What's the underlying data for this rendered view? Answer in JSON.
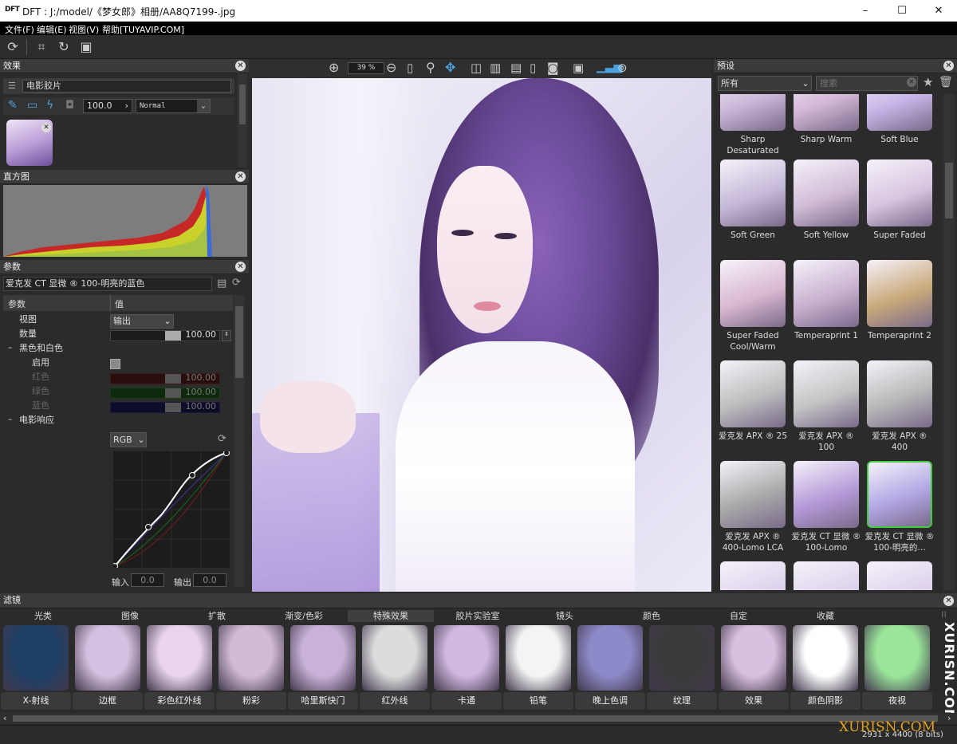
{
  "window": {
    "app_logo": "DFT",
    "title": "DFT : J:/model/《梦女郎》相册/AA8Q7199-.jpg",
    "minimize": "–",
    "maximize": "☐",
    "close": "✕"
  },
  "menu": [
    "文件(F)",
    "编辑(E)",
    "视图(V)",
    "帮助[TUYAVIP.COM]"
  ],
  "effects_panel": {
    "title": "效果",
    "effect_name": "电影胶片",
    "opacity": "100.0",
    "blend_mode": "Normal"
  },
  "histogram_panel": {
    "title": "直方图"
  },
  "params_panel": {
    "title": "参数",
    "preset_name": "爱克发 CT 显微 ® 100-明亮的蓝色",
    "col_param": "参数",
    "col_value": "值",
    "rows": [
      {
        "label": "视图",
        "value": "输出"
      },
      {
        "label": "数量",
        "value": "100.00"
      },
      {
        "label": "黑色和白色",
        "value": ""
      },
      {
        "label": "启用",
        "value": ""
      },
      {
        "label": "红色",
        "value": "100.00"
      },
      {
        "label": "绿色",
        "value": "100.00"
      },
      {
        "label": "蓝色",
        "value": "100.00"
      },
      {
        "label": "电影响应",
        "value": ""
      }
    ],
    "curve_channel": "RGB",
    "input_label": "输入",
    "input_value": "0.0",
    "output_label": "输出",
    "output_value": "0.0"
  },
  "viewer": {
    "zoom": "39 %"
  },
  "presets_panel": {
    "title": "预设",
    "category": "所有",
    "search_placeholder": "搜索",
    "items": [
      {
        "label": "Sharp Desaturated",
        "tint": "#c9b7d8"
      },
      {
        "label": "Sharp Warm",
        "tint": "#d4b8d8"
      },
      {
        "label": "Soft Blue",
        "tint": "#c6b6e8"
      },
      {
        "label": "Soft Green",
        "tint": "#c5b8d8"
      },
      {
        "label": "Soft Yellow",
        "tint": "#d0bcd6"
      },
      {
        "label": "Super Faded",
        "tint": "#d7c4e0"
      },
      {
        "label": "Super Faded Cool/Warm",
        "tint": "#d9b8d0"
      },
      {
        "label": "Temperaprint 1",
        "tint": "#c8b0d0"
      },
      {
        "label": "Temperaprint 2",
        "tint": "#c9a97a"
      },
      {
        "label": "爱克发 APX ® 25",
        "tint": "#bdbdbd"
      },
      {
        "label": "爱克发 APX ® 100",
        "tint": "#c4c4c4"
      },
      {
        "label": "爱克发 APX ® 400",
        "tint": "#b8b8b8"
      },
      {
        "label": "爱克发 APX ® 400-Lomo LCA",
        "tint": "#a9a9a9"
      },
      {
        "label": "爱克发 CT 显微 ® 100-Lomo",
        "tint": "#b49ad8"
      },
      {
        "label": "爱克发 CT 显微 ® 100-明亮的…",
        "tint": "#b2a6e4"
      }
    ]
  },
  "filters_panel": {
    "title": "滤镜",
    "tabs": [
      "光类",
      "图像",
      "扩散",
      "渐变/色彩",
      "特殊效果",
      "胶片实验室",
      "镜头",
      "颜色",
      "自定",
      "收藏"
    ],
    "active_tab": "特殊效果",
    "items": [
      {
        "label": "X-射线",
        "tint": "#1d3f66"
      },
      {
        "label": "边框",
        "tint": "#d4c0e0"
      },
      {
        "label": "彩色红外线",
        "tint": "#e8d4ec"
      },
      {
        "label": "粉彩",
        "tint": "#d2bcd4"
      },
      {
        "label": "哈里斯快门",
        "tint": "#c8b2d8"
      },
      {
        "label": "红外线",
        "tint": "#dcdcdc"
      },
      {
        "label": "卡通",
        "tint": "#d0b8e0"
      },
      {
        "label": "铅笔",
        "tint": "#f4f4f4"
      },
      {
        "label": "晚上色调",
        "tint": "#8c8ac8"
      },
      {
        "label": "纹理",
        "tint": "#3a3a3a"
      },
      {
        "label": "效果",
        "tint": "#d8c0e0"
      },
      {
        "label": "颜色阴影",
        "tint": "#ffffff"
      },
      {
        "label": "夜视",
        "tint": "#9be69b"
      }
    ]
  },
  "status": {
    "dimensions": "2931 x 4400 (8 bits)",
    "watermark": "XURISN.COM"
  },
  "colors": {
    "accent_selected": "#3fcc3f",
    "panel_bg": "#2b2b2b",
    "header_bg": "#3a3a3a"
  }
}
